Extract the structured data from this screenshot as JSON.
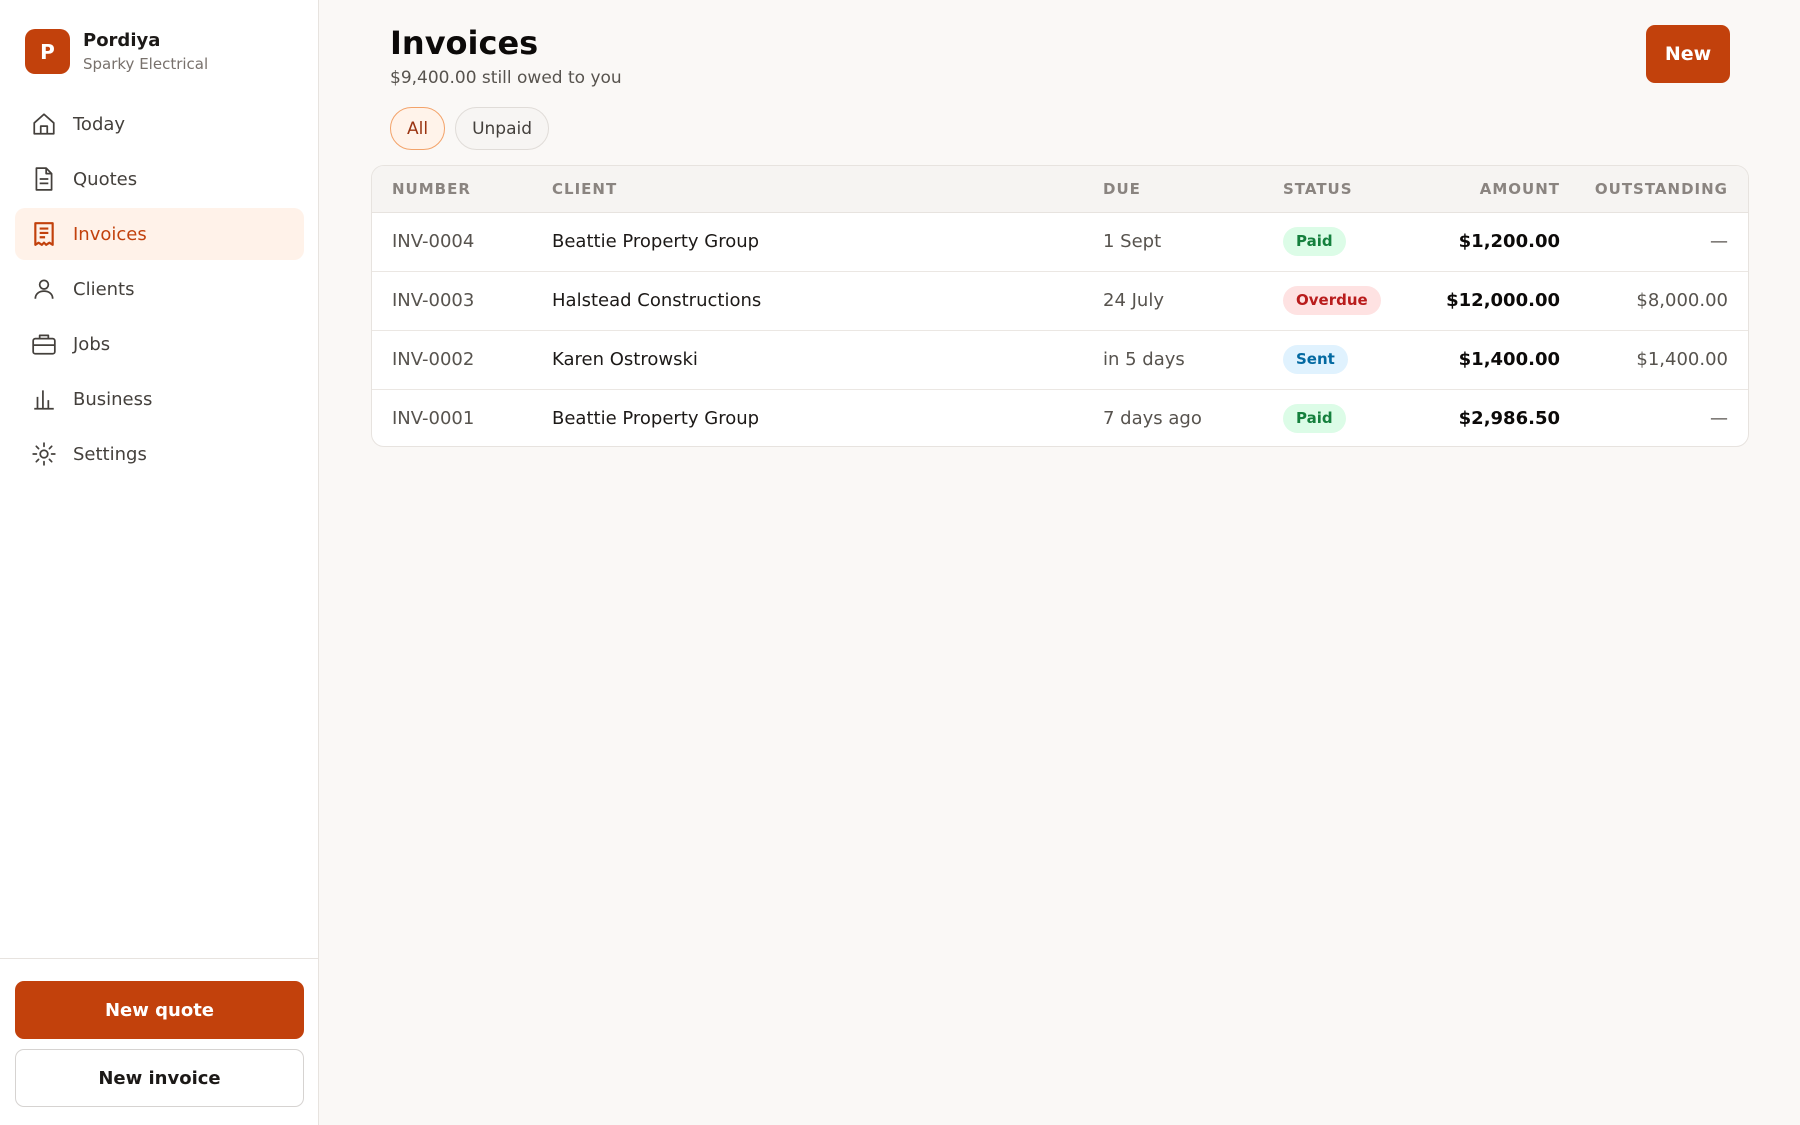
{
  "brand": {
    "initial": "P",
    "name": "Pordiya",
    "subtitle": "Sparky Electrical"
  },
  "nav": [
    {
      "label": "Today",
      "icon": "home-icon",
      "active": false
    },
    {
      "label": "Quotes",
      "icon": "document-icon",
      "active": false
    },
    {
      "label": "Invoices",
      "icon": "receipt-icon",
      "active": true
    },
    {
      "label": "Clients",
      "icon": "user-icon",
      "active": false
    },
    {
      "label": "Jobs",
      "icon": "briefcase-icon",
      "active": false
    },
    {
      "label": "Business",
      "icon": "bar-chart-icon",
      "active": false
    },
    {
      "label": "Settings",
      "icon": "gear-icon",
      "active": false
    }
  ],
  "footer": {
    "new_quote": "New quote",
    "new_invoice": "New invoice"
  },
  "header": {
    "title": "Invoices",
    "subtitle": "$9,400.00 still owed to you",
    "new_button": "New"
  },
  "filters": [
    {
      "label": "All",
      "active": true
    },
    {
      "label": "Unpaid",
      "active": false
    }
  ],
  "table": {
    "columns": [
      "NUMBER",
      "CLIENT",
      "DUE",
      "STATUS",
      "AMOUNT",
      "OUTSTANDING"
    ],
    "rows": [
      {
        "number": "INV-0004",
        "client": "Beattie Property Group",
        "due": "1 Sept",
        "status": "Paid",
        "amount": "$1,200.00",
        "outstanding": "—"
      },
      {
        "number": "INV-0003",
        "client": "Halstead Constructions",
        "due": "24 July",
        "status": "Overdue",
        "amount": "$12,000.00",
        "outstanding": "$8,000.00"
      },
      {
        "number": "INV-0002",
        "client": "Karen Ostrowski",
        "due": "in 5 days",
        "status": "Sent",
        "amount": "$1,400.00",
        "outstanding": "$1,400.00"
      },
      {
        "number": "INV-0001",
        "client": "Beattie Property Group",
        "due": "7 days ago",
        "status": "Paid",
        "amount": "$2,986.50",
        "outstanding": "—"
      }
    ]
  },
  "colors": {
    "accent": "#c2410c",
    "paid_bg": "#dcfce7",
    "paid_fg": "#15803d",
    "overdue_bg": "#fee2e2",
    "overdue_fg": "#b91c1c",
    "sent_bg": "#e0f2fe",
    "sent_fg": "#0369a1"
  }
}
